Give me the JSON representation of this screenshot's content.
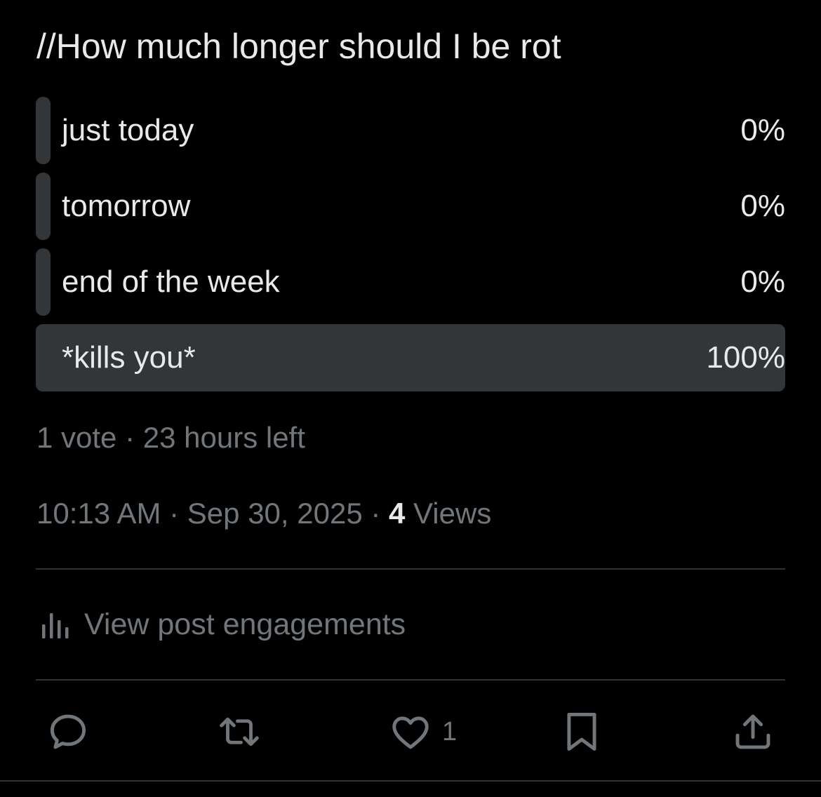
{
  "post": {
    "text": "//How much longer should I be rot"
  },
  "poll": {
    "options": [
      {
        "label": "just today",
        "percent_text": "0%",
        "share": 0
      },
      {
        "label": "tomorrow",
        "percent_text": "0%",
        "share": 0
      },
      {
        "label": "end of the week",
        "percent_text": "0%",
        "share": 0
      },
      {
        "label": "*kills you*",
        "percent_text": "100%",
        "share": 1
      }
    ],
    "votes": "1 vote",
    "separator": " · ",
    "time_left": "23 hours left"
  },
  "meta": {
    "time": "10:13 AM",
    "date": "Sep 30, 2025",
    "views_count": "4",
    "views_label": "Views",
    "separator": " · "
  },
  "engagements": {
    "label": "View post engagements",
    "icon": "bar-chart-icon"
  },
  "actions": {
    "reply_icon": "reply-icon",
    "repost_icon": "repost-icon",
    "like_icon": "heart-icon",
    "like_count": "1",
    "bookmark_icon": "bookmark-icon",
    "share_icon": "share-icon"
  },
  "colors": {
    "background": "#000000",
    "text_primary": "#e7e9ea",
    "text_secondary": "#71767b",
    "poll_bar": "#333639",
    "divider": "#2f3336"
  }
}
